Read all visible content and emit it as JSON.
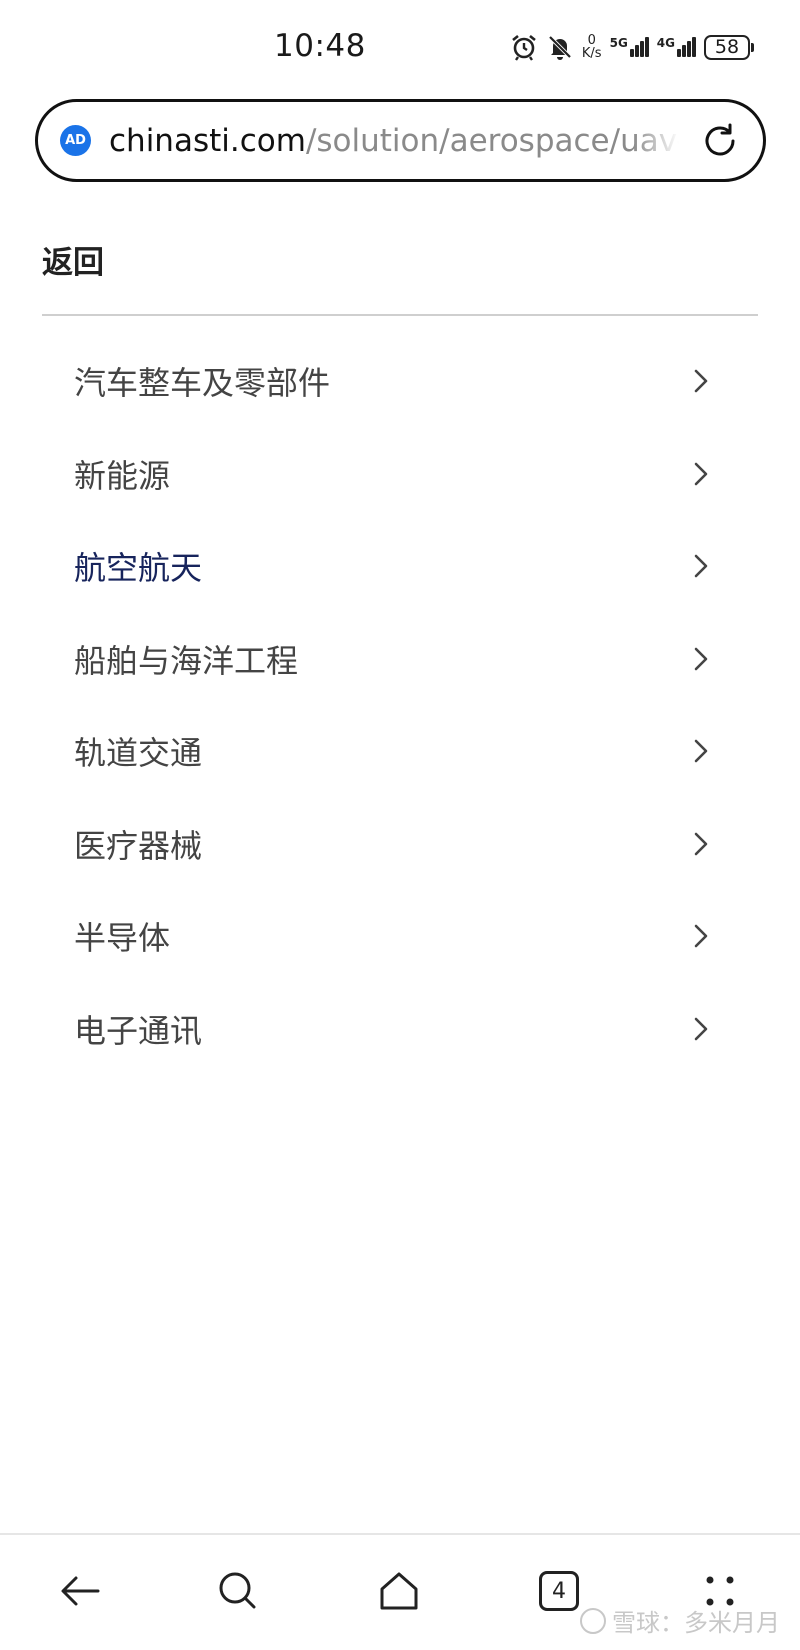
{
  "status_bar": {
    "time": "10:48",
    "speed_value": "0",
    "speed_unit": "K/s",
    "signal_1_label": "5G",
    "signal_2_label": "4G",
    "battery": "58",
    "icons": [
      "alarm-icon",
      "bell-muted-icon",
      "network-speed",
      "signal-5g-icon",
      "signal-4g-icon",
      "battery-icon"
    ]
  },
  "url_bar": {
    "badge": "AD",
    "host": "chinasti.com",
    "path": "/solution/aerospace/uav-"
  },
  "page": {
    "back_label": "返回",
    "menu": [
      {
        "label": "汽车整车及零部件",
        "active": false
      },
      {
        "label": "新能源",
        "active": false
      },
      {
        "label": "航空航天",
        "active": true
      },
      {
        "label": "船舶与海洋工程",
        "active": false
      },
      {
        "label": "轨道交通",
        "active": false
      },
      {
        "label": "医疗器械",
        "active": false
      },
      {
        "label": "半导体",
        "active": false
      },
      {
        "label": "电子通讯",
        "active": false
      }
    ]
  },
  "bottom_nav": {
    "tabs_count": "4",
    "items": [
      "back-arrow-icon",
      "search-icon",
      "home-icon",
      "tabs-icon",
      "menu-dots-icon"
    ]
  },
  "watermark": {
    "text": "雪球：多米月月"
  },
  "colors": {
    "active_item": "#17245c",
    "badge": "#1a73e8",
    "menu_text": "#444444"
  }
}
